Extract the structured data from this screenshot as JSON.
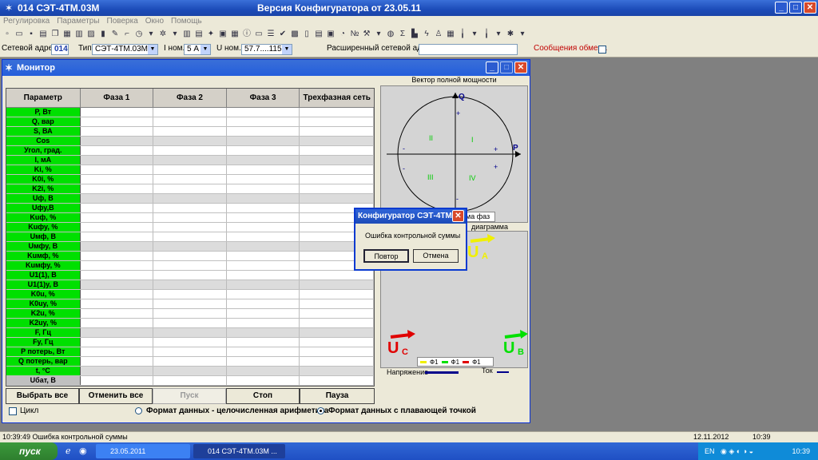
{
  "window": {
    "title_left": "014  СЭТ-4ТМ.03М",
    "title_center": "Версия Конфигуратора  от 23.05.11"
  },
  "menu": [
    "Регулировка",
    "Параметры",
    "Поверка",
    "Окно",
    "Помощь"
  ],
  "params_bar": {
    "net_addr_label": "Сетевой адрес",
    "net_addr_value": "014",
    "type_label": "Тип",
    "type_value": "СЭТ-4ТМ.03М",
    "inom_label": "I ном.",
    "inom_value": "5 А",
    "unom_label": "U ном.",
    "unom_value": "57.7....115 В",
    "ext_addr_label": "Расширенный сетевой адрес",
    "exchange_label": "Сообщения обмена"
  },
  "monitor": {
    "title": "Монитор",
    "columns": [
      "Параметр",
      "Фаза 1",
      "Фаза 2",
      "Фаза 3",
      "Трехфазная сеть"
    ],
    "params": [
      "P, Вт",
      "Q, вар",
      "S, ВА",
      "Cos",
      "Угол, град.",
      "I, мА",
      "Ki, %",
      "K0i, %",
      "K2i, %",
      "Uф, В",
      "Uфу,В",
      "Kuф, %",
      "Kuфу, %",
      "Uмф, В",
      "Uмфу, В",
      "Kuмф, %",
      "Kuмфу, %",
      "U1(1), В",
      "U1(1)у, В",
      "K0u, %",
      "K0uу, %",
      "K2u, %",
      "K2uу, %",
      "F, Гц",
      "Fу, Гц",
      "P потерь, Вт",
      "Q потерь, вар",
      "t, °C",
      "Uбат, В"
    ],
    "buttons": [
      "Выбрать все",
      "Отменить все",
      "Пуск",
      "Стоп",
      "Пауза"
    ],
    "cycle_label": "Цикл",
    "format_int": "Формат данных - целочисленная арифметика",
    "format_float": "Формат данных с плавающей точкой"
  },
  "vector": {
    "title": "Вектор полной мощности",
    "axis_q": "Q",
    "axis_p": "P",
    "quadrants": [
      "I",
      "II",
      "III",
      "IV"
    ],
    "phase_tab": "ма фаз",
    "diagram_title": "диаграмма"
  },
  "diagram": {
    "ua": "U",
    "ua_sub": "A",
    "ub": "U",
    "ub_sub": "B",
    "uc": "U",
    "uc_sub": "C",
    "legend": [
      "Ф1",
      "Ф1",
      "Ф1"
    ],
    "voltage_label": "Напряжение",
    "current_label": "Ток",
    "colors": {
      "phase_a": "#f0f000",
      "phase_b": "#00e000",
      "phase_c": "#e00000"
    }
  },
  "dialog": {
    "title": "Конфигуратор СЭТ-4ТМ",
    "message": "Ошибка контрольной суммы",
    "retry": "Повтор",
    "cancel": "Отмена"
  },
  "status": {
    "time_msg": "10:39:49  Ошибка контрольной суммы",
    "date": "12.11.2012",
    "time": "10:39"
  },
  "taskbar": {
    "start": "пуск",
    "item1": "23.05.2011",
    "item2": "014  СЭТ-4ТМ.03М   ...",
    "lang": "EN",
    "clock": "10:39"
  }
}
